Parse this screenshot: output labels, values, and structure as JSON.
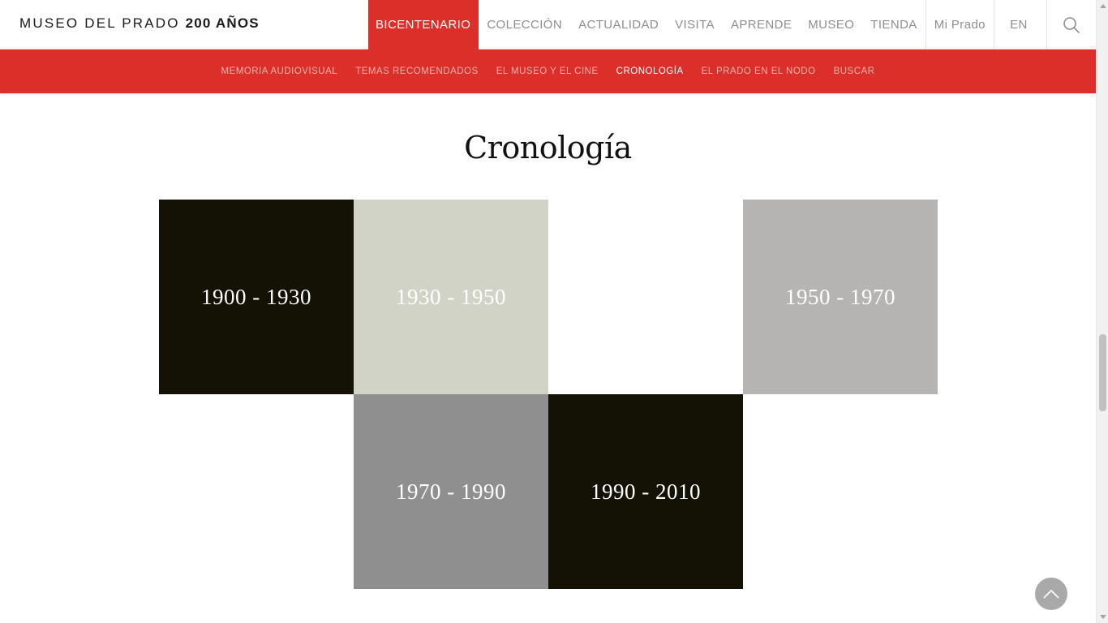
{
  "header": {
    "logo_text": "MUSEO DEL PRADO",
    "logo_bold": "200 AÑOS",
    "nav": [
      {
        "label": "BICENTENARIO",
        "active": true
      },
      {
        "label": "COLECCIÓN"
      },
      {
        "label": "ACTUALIDAD"
      },
      {
        "label": "VISITA"
      },
      {
        "label": "APRENDE"
      },
      {
        "label": "MUSEO"
      },
      {
        "label": "TIENDA"
      },
      {
        "label": "Mi Prado"
      },
      {
        "label": "EN"
      }
    ],
    "search_icon": "search-icon"
  },
  "subnav": [
    {
      "label": "MEMORIA AUDIOVISUAL"
    },
    {
      "label": "TEMAS RECOMENDADOS"
    },
    {
      "label": "EL MUSEO Y EL CINE"
    },
    {
      "label": "CRONOLOGÍA",
      "current": true
    },
    {
      "label": "EL PRADO EN EL NODO"
    },
    {
      "label": "BUSCAR"
    }
  ],
  "main": {
    "title": "Cronología",
    "periods": [
      {
        "label": "1900 - 1930",
        "color": "#141205"
      },
      {
        "label": "1930 - 1950",
        "color": "#d1d3c7"
      },
      {
        "label": "1950 - 1970",
        "color": "#b5b4b2"
      },
      {
        "label": "1970 - 1990",
        "color": "#8f8f8f"
      },
      {
        "label": "1990 - 2010",
        "color": "#141205"
      }
    ]
  },
  "colors": {
    "accent": "#dc2f2a",
    "nav_text": "#8e8e8e"
  },
  "back_to_top_icon": "chevron-up-icon"
}
